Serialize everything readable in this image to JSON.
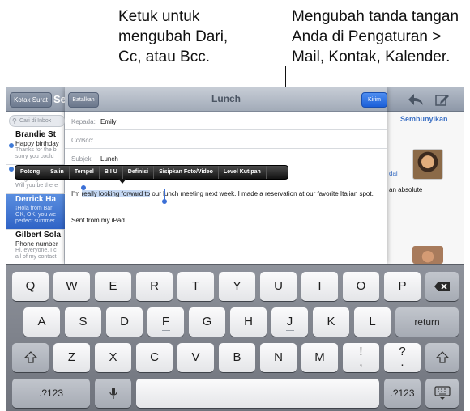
{
  "callouts": {
    "left": [
      "Ketuk untuk",
      "mengubah Dari,",
      "Cc, atau Bcc."
    ],
    "right": [
      "Mengubah tanda tangan",
      "Anda di Pengaturan >",
      "Mail, Kontak, Kalender."
    ]
  },
  "mail": {
    "back_label": "Kotak Surat",
    "list_title": "Se",
    "search_placeholder": "Cari di Inbox",
    "hide_label": "Sembunyikan",
    "detail_text1": "dai",
    "detail_text2": "an absolute",
    "messages": [
      {
        "from": "Brandie St",
        "subject": "Happy birthday",
        "preview1": "Thanks for the b",
        "preview2": "sorry you could"
      },
      {
        "from": "",
        "subject": "",
        "preview1": "I'm going in for",
        "preview2": "Will you be there"
      },
      {
        "from": "Derrick Ha",
        "subject": "",
        "preview1": "¡Hola from Bar",
        "preview2": "OK, OK, you we",
        "preview3": "perfect summer"
      },
      {
        "from": "Gilbert Sola",
        "subject": "Phone number",
        "preview1": "Hi, everyone. I c",
        "preview2": "all of my contact"
      }
    ]
  },
  "compose": {
    "cancel_label": "Batalkan",
    "title": "Lunch",
    "send_label": "Kirim",
    "to_label": "Kepada:",
    "to_value": "Emily",
    "cc_label": "Cc/Bcc:",
    "subject_label": "Subjek:",
    "subject_value": "Lunch",
    "body_before": "I'm ",
    "body_selected": "really looking forward to",
    "body_after": " our lunch meeting next week. I made a reservation at our favorite Italian spot.",
    "signature": "Sent from my iPad"
  },
  "edit_menu": [
    "Potong",
    "Salin",
    "Tempel",
    "B I U",
    "Definisi",
    "Sisipkan Foto/Video",
    "Level Kutipan"
  ],
  "keyboard": {
    "row1": [
      "Q",
      "W",
      "E",
      "R",
      "T",
      "Y",
      "U",
      "I",
      "O",
      "P"
    ],
    "row2": [
      "A",
      "S",
      "D",
      "F",
      "G",
      "H",
      "J",
      "K",
      "L"
    ],
    "row3": [
      "Z",
      "X",
      "C",
      "V",
      "B",
      "N",
      "M"
    ],
    "return_label": "return",
    "numbers_label": ".?123",
    "exclaim_top": "!",
    "exclaim_bottom": ",",
    "question_top": "?",
    "question_bottom": "."
  }
}
